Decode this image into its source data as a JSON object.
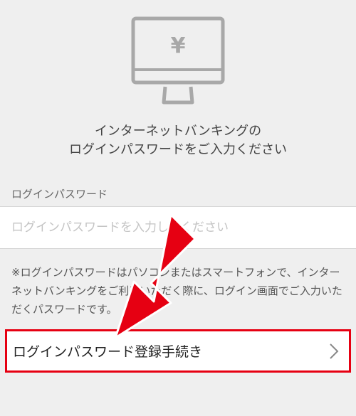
{
  "header": {
    "icon": "computer-yen-icon",
    "currency_symbol": "¥"
  },
  "instruction": {
    "line1": "インターネットバンキングの",
    "line2": "ログインパスワードをご入力ください"
  },
  "password_field": {
    "label": "ログインパスワード",
    "placeholder": "ログインパスワードを入力してください",
    "value": ""
  },
  "note": {
    "text": "※ログインパスワードはパソコンまたはスマートフォンで、インターネットバンキングをご利用いただく際に、ログイン画面でご入力いただくパスワードです。"
  },
  "register": {
    "label": "ログインパスワード登録手続き",
    "icon": "chevron-right-icon"
  },
  "colors": {
    "background": "#efefef",
    "highlight": "#e60012",
    "icon_gray": "#a8a8a8"
  }
}
